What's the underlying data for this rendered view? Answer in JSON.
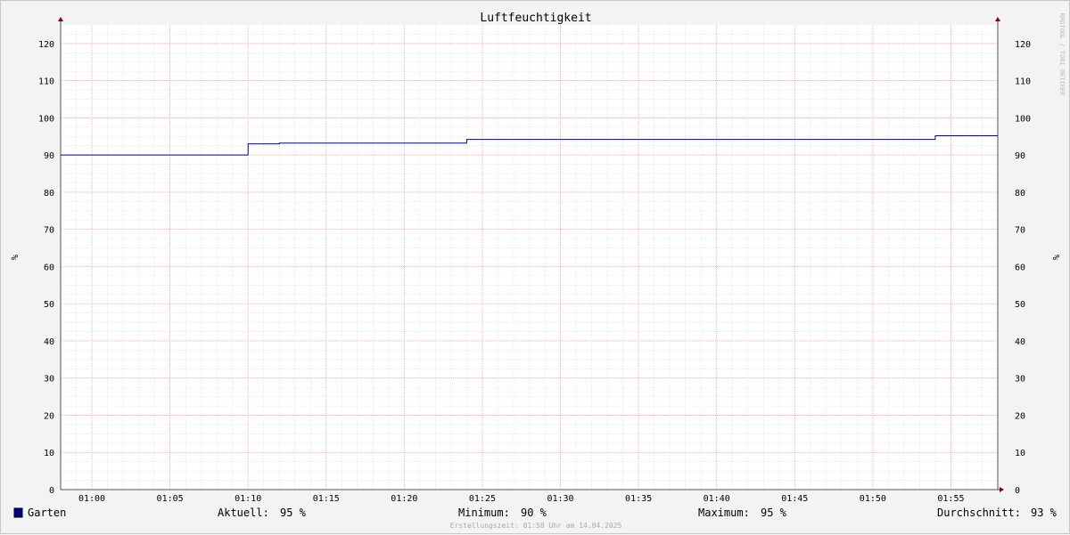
{
  "chart_data": {
    "type": "line",
    "title": "Luftfeuchtigkeit",
    "ylabel": "%",
    "ylim": [
      0,
      125
    ],
    "yticks": [
      0,
      10,
      20,
      30,
      40,
      50,
      60,
      70,
      80,
      90,
      100,
      110,
      120
    ],
    "xlim": [
      "00:58",
      "01:58"
    ],
    "xticks": [
      "01:00",
      "01:05",
      "01:10",
      "01:15",
      "01:20",
      "01:25",
      "01:30",
      "01:35",
      "01:40",
      "01:45",
      "01:50",
      "01:55"
    ],
    "grid": true,
    "legend_placement": "bottom",
    "series": [
      {
        "name": "Garten",
        "color": "#00008b",
        "x": [
          "00:58",
          "01:10",
          "01:12",
          "01:24",
          "01:54",
          "01:58"
        ],
        "y": [
          90,
          93,
          93.2,
          94.2,
          95.2,
          95.2
        ]
      }
    ],
    "watermark": "RRDTOOL / TOBI OETIKER",
    "footer": "Erstellungszeit: 01:58 Uhr am 14.04.2025"
  },
  "legend": {
    "series_name": "Garten",
    "stats": [
      {
        "label": "Aktuell:",
        "value": "95 %"
      },
      {
        "label": "Minimum:",
        "value": "90 %"
      },
      {
        "label": "Maximum:",
        "value": "95 %"
      },
      {
        "label": "Durchschnitt:",
        "value": "93 %"
      }
    ]
  }
}
